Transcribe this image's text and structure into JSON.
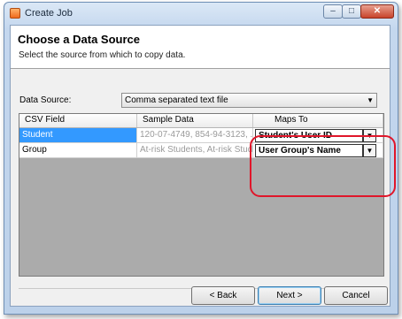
{
  "window": {
    "title": "Create Job",
    "controls": {
      "minimize": "–",
      "maximize": "□",
      "close": "✕"
    }
  },
  "header": {
    "title": "Choose a Data Source",
    "subtitle": "Select the source from which to copy data."
  },
  "data_source": {
    "label": "Data Source:",
    "selected": "Comma separated text file",
    "arrow": "▼"
  },
  "grid": {
    "columns": [
      "CSV Field",
      "Sample Data",
      "Maps To"
    ],
    "rows": [
      {
        "csv_field": "Student",
        "sample": "120-07-4749, 854-94-3123, ...",
        "maps_to": "Student's User ID"
      },
      {
        "csv_field": "Group",
        "sample": "At-risk Students, At-risk Stude...",
        "maps_to": "User Group's Name"
      }
    ]
  },
  "buttons": {
    "back": "< Back",
    "next": "Next >",
    "cancel": "Cancel"
  },
  "colors": {
    "selection": "#3399ff",
    "annotation": "#e0162a",
    "grid_background": "#ababab"
  }
}
